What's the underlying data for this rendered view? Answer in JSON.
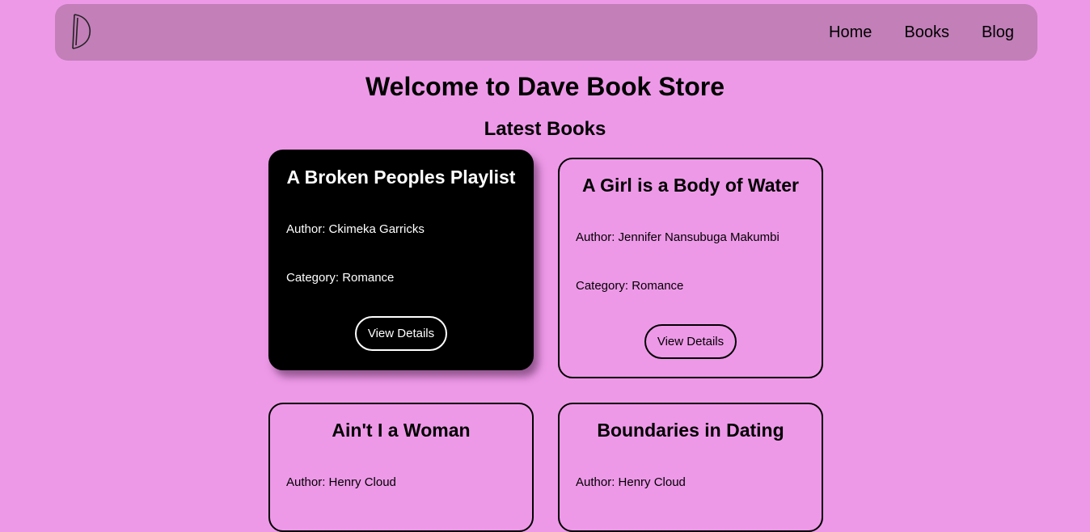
{
  "nav": {
    "links": [
      "Home",
      "Books",
      "Blog"
    ]
  },
  "page": {
    "title": "Welcome to Dave Book Store",
    "section": "Latest Books"
  },
  "books": [
    {
      "title": "A Broken Peoples Playlist",
      "author": "Author: Ckimeka Garricks",
      "category": "Category: Romance",
      "button": "View Details"
    },
    {
      "title": "A Girl is a Body of Water",
      "author": "Author: Jennifer Nansubuga Makumbi",
      "category": "Category: Romance",
      "button": "View Details"
    },
    {
      "title": "Ain't I a Woman",
      "author": "Author: Henry Cloud",
      "category": "",
      "button": ""
    },
    {
      "title": "Boundaries in Dating",
      "author": "Author: Henry Cloud",
      "category": "",
      "button": ""
    }
  ],
  "colors": {
    "background": "#ee99e8",
    "navbar": "#c27fb8",
    "dark_card": "#000000"
  }
}
